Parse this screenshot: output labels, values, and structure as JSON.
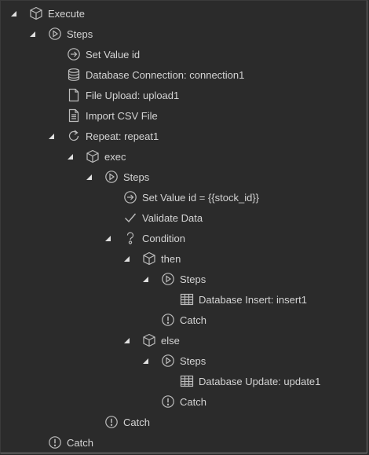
{
  "tree": {
    "items": [
      {
        "label": "Execute",
        "icon": "cube-icon",
        "expanded": true
      },
      {
        "label": "Steps",
        "icon": "play-circle-icon",
        "expanded": true
      },
      {
        "label": "Set Value id",
        "icon": "arrow-right-circle-icon"
      },
      {
        "label": "Database Connection: connection1",
        "icon": "database-icon"
      },
      {
        "label": "File Upload: upload1",
        "icon": "file-icon"
      },
      {
        "label": "Import CSV File",
        "icon": "document-lines-icon"
      },
      {
        "label": "Repeat: repeat1",
        "icon": "repeat-icon",
        "expanded": true
      },
      {
        "label": "exec",
        "icon": "cube-icon",
        "expanded": true
      },
      {
        "label": "Steps",
        "icon": "play-circle-icon",
        "expanded": true
      },
      {
        "label": "Set Value id = {{stock_id}}",
        "icon": "arrow-right-circle-icon"
      },
      {
        "label": "Validate Data",
        "icon": "checkmark-icon"
      },
      {
        "label": "Condition",
        "icon": "question-icon",
        "expanded": true
      },
      {
        "label": "then",
        "icon": "cube-icon",
        "expanded": true
      },
      {
        "label": "Steps",
        "icon": "play-circle-icon",
        "expanded": true
      },
      {
        "label": "Database Insert: insert1",
        "icon": "table-icon"
      },
      {
        "label": "Catch",
        "icon": "exclamation-circle-icon"
      },
      {
        "label": "else",
        "icon": "cube-icon",
        "expanded": true
      },
      {
        "label": "Steps",
        "icon": "play-circle-icon",
        "expanded": true
      },
      {
        "label": "Database Update: update1",
        "icon": "table-icon"
      },
      {
        "label": "Catch",
        "icon": "exclamation-circle-icon"
      },
      {
        "label": "Catch",
        "icon": "exclamation-circle-icon"
      },
      {
        "label": "Catch",
        "icon": "exclamation-circle-icon"
      }
    ]
  }
}
